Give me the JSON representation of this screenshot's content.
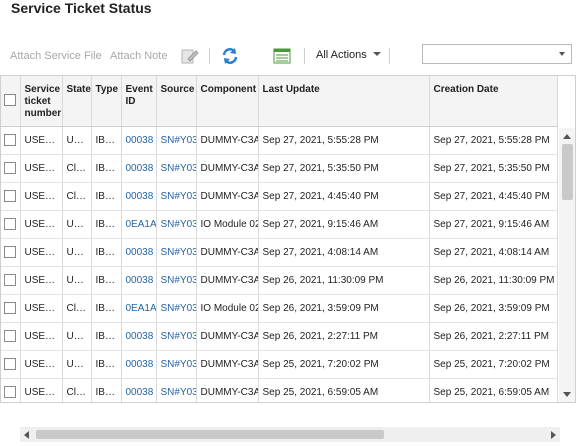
{
  "page": {
    "title": "Service Ticket Status"
  },
  "toolbar": {
    "attach_file": "Attach Service File",
    "attach_note": "Attach Note",
    "all_actions": "All Actions",
    "filter_value": ""
  },
  "table": {
    "columns": [
      "",
      "Service ticket number",
      "State",
      "Type",
      "Event ID",
      "Source",
      "Component",
      "Last Update",
      "Creation Date"
    ],
    "rows": [
      [
        "USE…",
        "U…",
        "IB…",
        "00038",
        "SN#Y03",
        "DUMMY-C3A",
        "Sep 27, 2021, 5:55:28 PM",
        "Sep 27, 2021, 5:55:28 PM"
      ],
      [
        "USE…",
        "Cl…",
        "IB…",
        "00038",
        "SN#Y03",
        "DUMMY-C3A",
        "Sep 27, 2021, 5:35:50 PM",
        "Sep 27, 2021, 5:35:50 PM"
      ],
      [
        "USE…",
        "Cl…",
        "IB…",
        "00038",
        "SN#Y03",
        "DUMMY-C3A",
        "Sep 27, 2021, 4:45:40 PM",
        "Sep 27, 2021, 4:45:40 PM"
      ],
      [
        "USE…",
        "U…",
        "IB…",
        "0EA1A",
        "SN#Y03",
        "IO Module 02",
        "Sep 27, 2021, 9:15:46 AM",
        "Sep 27, 2021, 9:15:46 AM"
      ],
      [
        "USE…",
        "U…",
        "IB…",
        "00038",
        "SN#Y03",
        "DUMMY-C3A",
        "Sep 27, 2021, 4:08:14 AM",
        "Sep 27, 2021, 4:08:14 AM"
      ],
      [
        "USE…",
        "U…",
        "IB…",
        "00038",
        "SN#Y03",
        "DUMMY-C3A",
        "Sep 26, 2021, 11:30:09 PM",
        "Sep 26, 2021, 11:30:09 PM"
      ],
      [
        "USE…",
        "Cl…",
        "IB…",
        "0EA1A",
        "SN#Y03",
        "IO Module 02",
        "Sep 26, 2021, 3:59:09 PM",
        "Sep 26, 2021, 3:59:09 PM"
      ],
      [
        "USE…",
        "U…",
        "IB…",
        "00038",
        "SN#Y03",
        "DUMMY-C3A",
        "Sep 26, 2021, 2:27:11 PM",
        "Sep 26, 2021, 2:27:11 PM"
      ],
      [
        "USE…",
        "U…",
        "IB…",
        "00038",
        "SN#Y03",
        "DUMMY-C3A",
        "Sep 25, 2021, 7:20:02 PM",
        "Sep 25, 2021, 7:20:02 PM"
      ],
      [
        "USE…",
        "Cl…",
        "IB…",
        "00038",
        "SN#Y03",
        "DUMMY-C3A",
        "Sep 25, 2021, 6:59:05 AM",
        "Sep 25, 2021, 6:59:05 AM"
      ]
    ]
  },
  "icons": {
    "edit": "edit-icon",
    "refresh": "refresh-icon",
    "export": "export-icon"
  },
  "colors": {
    "link": "#2465a6",
    "disabled_text": "#a8a8a8",
    "header_bg": "#f4f4f4",
    "refresh_icon": "#2b7fd1",
    "export_icon": "#4a9a3a"
  }
}
